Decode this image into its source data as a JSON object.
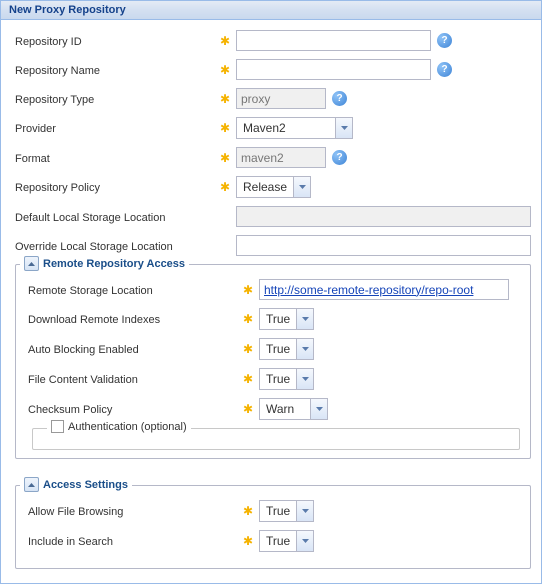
{
  "header": {
    "title": "New Proxy Repository"
  },
  "fields": {
    "repo_id": {
      "label": "Repository ID",
      "value": ""
    },
    "repo_name": {
      "label": "Repository Name",
      "value": ""
    },
    "repo_type": {
      "label": "Repository Type",
      "value": "proxy"
    },
    "provider": {
      "label": "Provider",
      "value": "Maven2"
    },
    "format": {
      "label": "Format",
      "value": "maven2"
    },
    "policy": {
      "label": "Repository Policy",
      "value": "Release"
    },
    "default_storage": {
      "label": "Default Local Storage Location",
      "value": ""
    },
    "override_storage": {
      "label": "Override Local Storage Location",
      "value": ""
    }
  },
  "remote": {
    "legend": "Remote Repository Access",
    "storage_loc": {
      "label": "Remote Storage Location",
      "value": "http://some-remote-repository/repo-root"
    },
    "download_indexes": {
      "label": "Download Remote Indexes",
      "value": "True"
    },
    "auto_blocking": {
      "label": "Auto Blocking Enabled",
      "value": "True"
    },
    "file_validation": {
      "label": "File Content Validation",
      "value": "True"
    },
    "checksum": {
      "label": "Checksum Policy",
      "value": "Warn"
    },
    "auth_legend": "Authentication (optional)"
  },
  "access": {
    "legend": "Access Settings",
    "allow_browse": {
      "label": "Allow File Browsing",
      "value": "True"
    },
    "include_search": {
      "label": "Include in Search",
      "value": "True"
    }
  }
}
